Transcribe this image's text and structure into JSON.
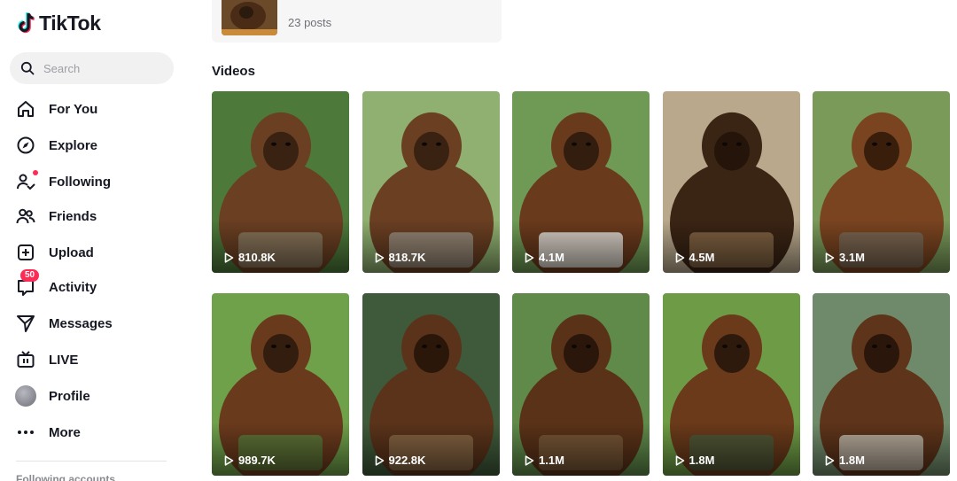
{
  "app": {
    "name": "TikTok"
  },
  "search": {
    "placeholder": "Search"
  },
  "nav": {
    "items": [
      {
        "label": "For You",
        "icon": "home-icon"
      },
      {
        "label": "Explore",
        "icon": "compass-icon"
      },
      {
        "label": "Following",
        "icon": "following-icon"
      },
      {
        "label": "Friends",
        "icon": "friends-icon"
      },
      {
        "label": "Upload",
        "icon": "upload-icon"
      },
      {
        "label": "Activity",
        "icon": "activity-icon",
        "badge": "50"
      },
      {
        "label": "Messages",
        "icon": "send-icon"
      },
      {
        "label": "LIVE",
        "icon": "live-icon"
      },
      {
        "label": "Profile",
        "icon": "avatar"
      },
      {
        "label": "More",
        "icon": "more-icon"
      }
    ],
    "following_accounts_title": "Following accounts"
  },
  "header": {
    "post_count": "23 posts"
  },
  "videos": {
    "title": "Videos",
    "items": [
      {
        "views": "810.8K"
      },
      {
        "views": "818.7K"
      },
      {
        "views": "4.1M"
      },
      {
        "views": "4.5M"
      },
      {
        "views": "3.1M"
      },
      {
        "views": "989.7K"
      },
      {
        "views": "922.8K"
      },
      {
        "views": "1.1M"
      },
      {
        "views": "1.8M"
      },
      {
        "views": "1.8M"
      }
    ]
  },
  "colors": {
    "brand_red": "#fe2c55",
    "brand_cyan": "#25f4ee",
    "text": "#161823"
  }
}
